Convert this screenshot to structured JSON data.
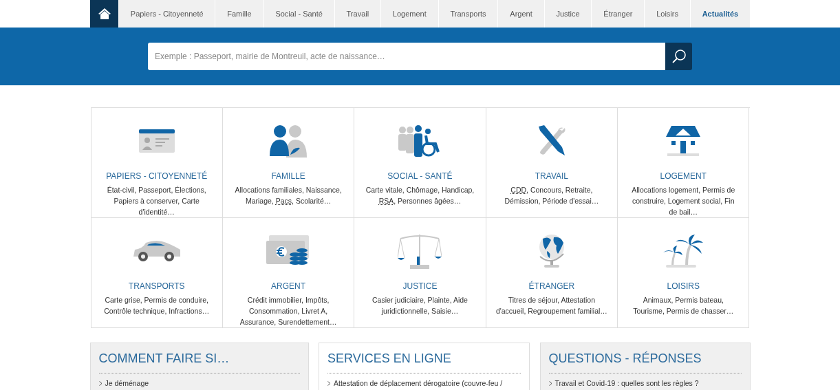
{
  "nav": {
    "items": [
      {
        "label": "Papiers - Citoyenneté",
        "selected": false
      },
      {
        "label": "Famille",
        "selected": false
      },
      {
        "label": "Social - Santé",
        "selected": false
      },
      {
        "label": "Travail",
        "selected": false
      },
      {
        "label": "Logement",
        "selected": false
      },
      {
        "label": "Transports",
        "selected": false
      },
      {
        "label": "Argent",
        "selected": false
      },
      {
        "label": "Justice",
        "selected": false
      },
      {
        "label": "Étranger",
        "selected": false
      },
      {
        "label": "Loisirs",
        "selected": false
      },
      {
        "label": "Actualités",
        "selected": true
      }
    ]
  },
  "search": {
    "placeholder": "Exemple : Passeport, mairie de Montreuil, acte de naissance…"
  },
  "categories": [
    {
      "title": "PAPIERS - CITOYENNETÉ",
      "description": [
        {
          "text": "État-civil, Passeport, Élections, Papiers à conserver, Carte d'identité…"
        }
      ]
    },
    {
      "title": "FAMILLE",
      "description": [
        {
          "text": "Allocations familiales, Naissance, Mariage, "
        },
        {
          "text": "Pacs",
          "abbr": true
        },
        {
          "text": ", Scolarité…"
        }
      ]
    },
    {
      "title": "SOCIAL - SANTÉ",
      "description": [
        {
          "text": "Carte vitale, Chômage, Handicap, "
        },
        {
          "text": "RSA",
          "abbr": true
        },
        {
          "text": ", Personnes âgées…"
        }
      ]
    },
    {
      "title": "TRAVAIL",
      "description": [
        {
          "text": "CDD",
          "abbr": true
        },
        {
          "text": ", Concours, Retraite, Démission, Période d'essai…"
        }
      ]
    },
    {
      "title": "LOGEMENT",
      "description": [
        {
          "text": "Allocations logement, Permis de construire, Logement social, Fin de bail…"
        }
      ]
    },
    {
      "title": "TRANSPORTS",
      "description": [
        {
          "text": "Carte grise, Permis de conduire, Contrôle technique, Infractions…"
        }
      ]
    },
    {
      "title": "ARGENT",
      "description": [
        {
          "text": "Crédit immobilier, Impôts, Consommation, Livret A, Assurance, Surendettement…"
        }
      ]
    },
    {
      "title": "JUSTICE",
      "description": [
        {
          "text": "Casier judiciaire, Plainte, Aide juridictionnelle, Saisie…"
        }
      ]
    },
    {
      "title": "ÉTRANGER",
      "description": [
        {
          "text": "Titres de séjour, Attestation d'accueil, Regroupement familial…"
        }
      ]
    },
    {
      "title": "LOISIRS",
      "description": [
        {
          "text": "Animaux, Permis bateau, Tourisme, Permis de chasser…"
        }
      ]
    }
  ],
  "panels": [
    {
      "title": "COMMENT FAIRE SI…",
      "kind": "grey",
      "links": [
        "Je déménage"
      ]
    },
    {
      "title": "SERVICES EN LIGNE",
      "kind": "white",
      "links": [
        "Attestation de déplacement dérogatoire (couvre-feu /"
      ]
    },
    {
      "title": "QUESTIONS - RÉPONSES",
      "kind": "grey",
      "links": [
        "Travail et Covid-19 : quelles sont les règles ?"
      ]
    }
  ]
}
